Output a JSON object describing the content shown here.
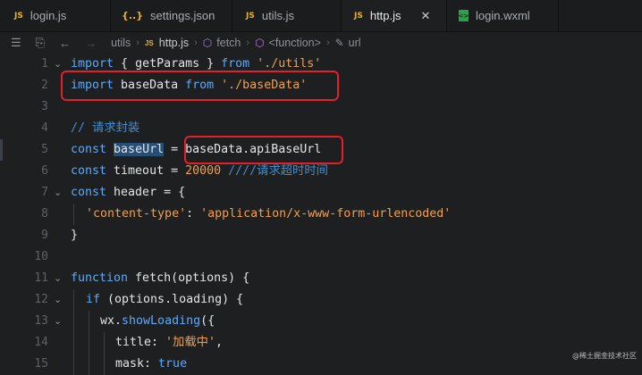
{
  "tabs": [
    {
      "label": "login.js",
      "icon": "js-file-icon",
      "active": false
    },
    {
      "label": "settings.json",
      "icon": "json-file-icon",
      "active": false
    },
    {
      "label": "utils.js",
      "icon": "js-file-icon",
      "active": false
    },
    {
      "label": "http.js",
      "icon": "js-file-icon",
      "active": true
    },
    {
      "label": "login.wxml",
      "icon": "wxml-file-icon",
      "active": false
    }
  ],
  "tab_icon_text": {
    "js": "JS",
    "json": "{..}",
    "wxml": "<>"
  },
  "breadcrumb": {
    "folder": "utils",
    "file": "http.js",
    "fetch": "fetch",
    "function": "<function>",
    "current": "url"
  },
  "code": {
    "line_numbers": [
      "1",
      "2",
      "3",
      "4",
      "5",
      "6",
      "7",
      "8",
      "9",
      "10",
      "11",
      "12",
      "13",
      "14",
      "15"
    ],
    "l1": {
      "kw1": "import",
      "mid": " { getParams } ",
      "kw2": "from",
      "sp": " ",
      "str": "'./utils'"
    },
    "l2": {
      "kw1": "import",
      "mid": " baseData ",
      "kw2": "from",
      "sp": " ",
      "str": "'./baseData'"
    },
    "l4": {
      "comment": "// 请求封装"
    },
    "l5": {
      "kw": "const",
      "sp": " ",
      "var": "baseUrl",
      "eq": " = ",
      "rhs": "baseData.apiBaseUrl"
    },
    "l6": {
      "kw": "const",
      "mid": " timeout = ",
      "num": "20000",
      "comment": " ////请求超时时间"
    },
    "l7": {
      "kw": "const",
      "mid": " header = {"
    },
    "l8": {
      "key": "'content-type'",
      "colon": ": ",
      "val": "'application/x-www-form-urlencoded'"
    },
    "l9": {
      "text": "}"
    },
    "l11": {
      "kw": "function",
      "mid": " fetch(options) {"
    },
    "l12": {
      "kw": "if",
      "mid": " (options.loading) {"
    },
    "l13": {
      "obj": "wx.",
      "method": "showLoading",
      "rest": "({"
    },
    "l14": {
      "key": "title",
      "colon": ": ",
      "val": "'加载中'",
      "comma": ","
    },
    "l15": {
      "key": "mask",
      "colon": ": ",
      "val": "true"
    }
  },
  "watermark": "@稀土掘金技术社区",
  "colors": {
    "keyword": "#5fa9f5",
    "string": "#f0a04b",
    "comment": "#3f8fd3",
    "highlight_box": "#e0202a"
  }
}
